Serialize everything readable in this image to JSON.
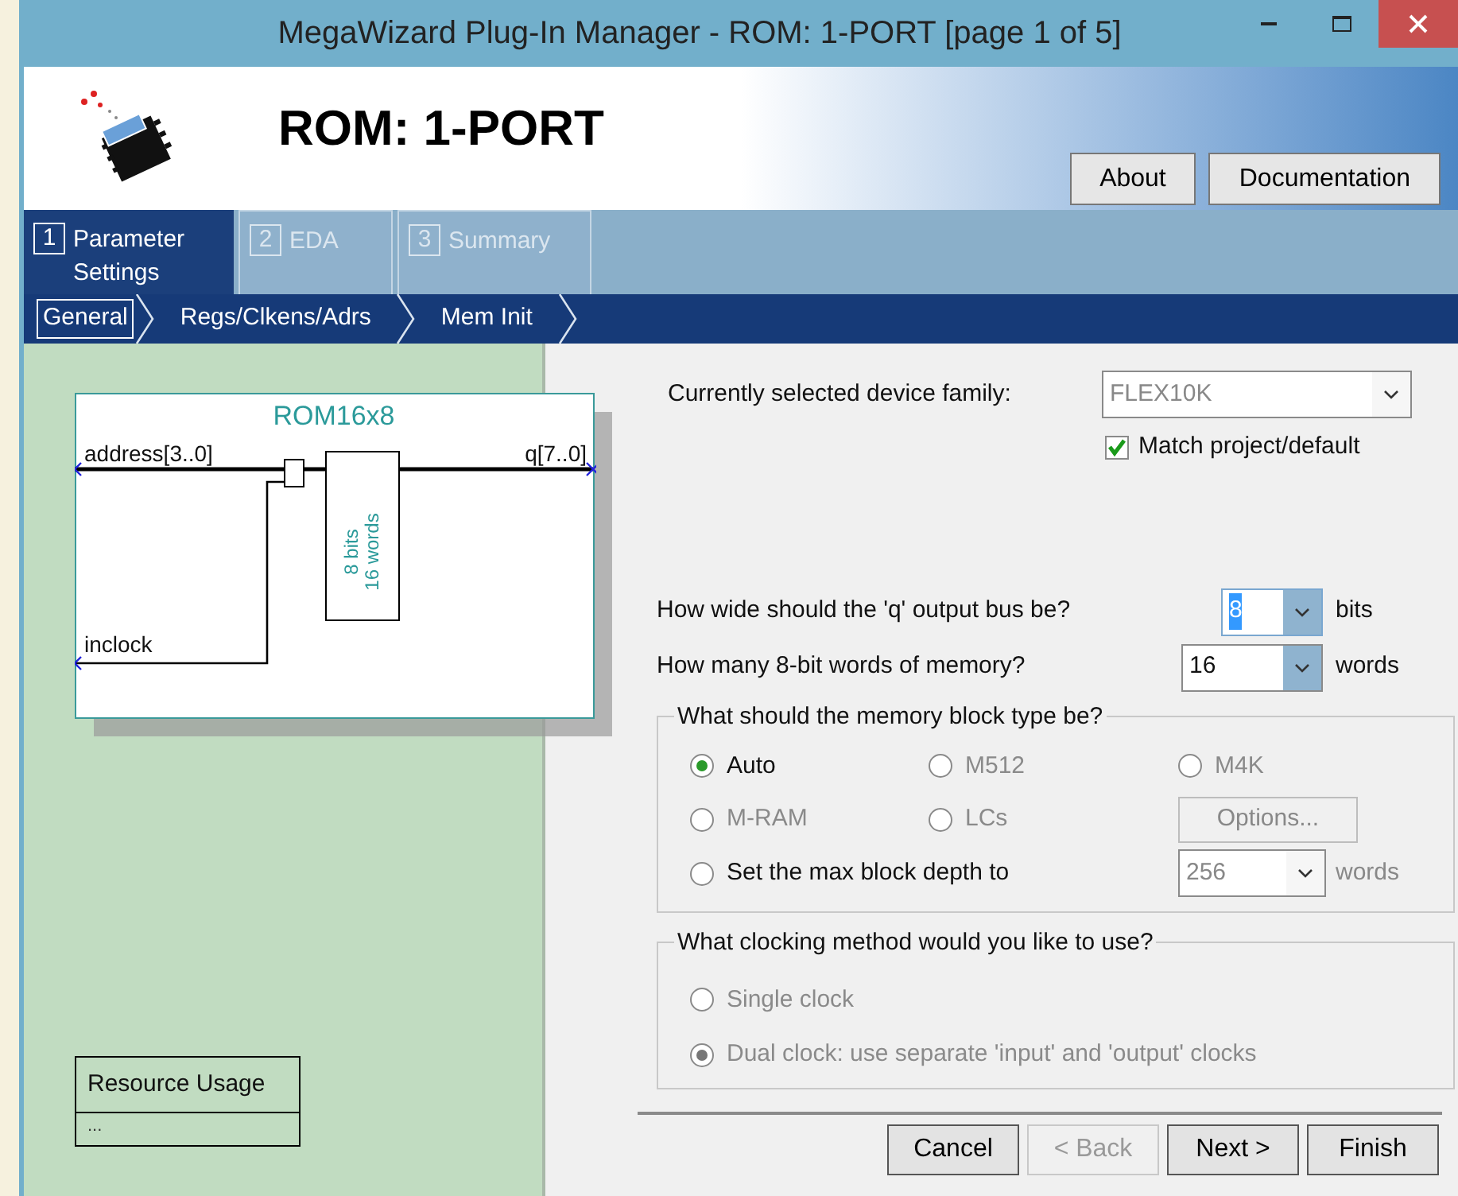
{
  "window": {
    "title": "MegaWizard Plug-In Manager - ROM: 1-PORT [page 1 of 5]"
  },
  "header": {
    "title": "ROM: 1-PORT",
    "buttons": [
      {
        "label": "About"
      },
      {
        "label": "Documentation"
      }
    ]
  },
  "tabs": [
    {
      "number": "1",
      "label": "Parameter Settings",
      "selected": true
    },
    {
      "number": "2",
      "label": "EDA",
      "selected": false
    },
    {
      "number": "3",
      "label": "Summary",
      "selected": false
    }
  ],
  "steps": [
    {
      "label": "General",
      "selected": true
    },
    {
      "label": "Regs/Clkens/Adrs",
      "selected": false
    },
    {
      "label": "Mem Init",
      "selected": false
    }
  ],
  "diagram": {
    "title": "ROM16x8",
    "inputs": [
      "address[3..0]",
      "inclock"
    ],
    "output": "q[7..0]",
    "block_lines": [
      "8 bits",
      "16 words"
    ]
  },
  "resource_usage": {
    "title": "Resource Usage",
    "value": "..."
  },
  "device": {
    "label": "Currently selected device family:",
    "value": "FLEX10K",
    "match": {
      "label": "Match project/default",
      "checked": true
    }
  },
  "q_width": {
    "label": "How wide should the 'q' output bus be?",
    "value": "8",
    "unit": "bits"
  },
  "words": {
    "label": "How many 8-bit words of memory?",
    "value": "16",
    "unit": "words"
  },
  "memory_block": {
    "legend": "What should the memory block type be?",
    "options": [
      {
        "label": "Auto",
        "selected": true,
        "disabled": false
      },
      {
        "label": "M512",
        "selected": false,
        "disabled": true
      },
      {
        "label": "M4K",
        "selected": false,
        "disabled": true
      },
      {
        "label": "M-RAM",
        "selected": false,
        "disabled": true
      },
      {
        "label": "LCs",
        "selected": false,
        "disabled": true
      }
    ],
    "options_button": {
      "label": "Options...",
      "disabled": true
    },
    "max_depth": {
      "label": "Set the max block depth to",
      "selected": false,
      "value": "256",
      "unit": "words",
      "disabled": true
    }
  },
  "clocking": {
    "legend": "What clocking method would you like to use?",
    "options": [
      {
        "label": "Single clock",
        "selected": false,
        "disabled": true
      },
      {
        "label": "Dual clock: use separate 'input' and 'output' clocks",
        "selected": true,
        "disabled": true
      }
    ]
  },
  "footer_buttons": [
    {
      "label": "Cancel",
      "disabled": false
    },
    {
      "label": "< Back",
      "disabled": true
    },
    {
      "label": "Next >",
      "disabled": false
    },
    {
      "label": "Finish",
      "disabled": false
    }
  ]
}
